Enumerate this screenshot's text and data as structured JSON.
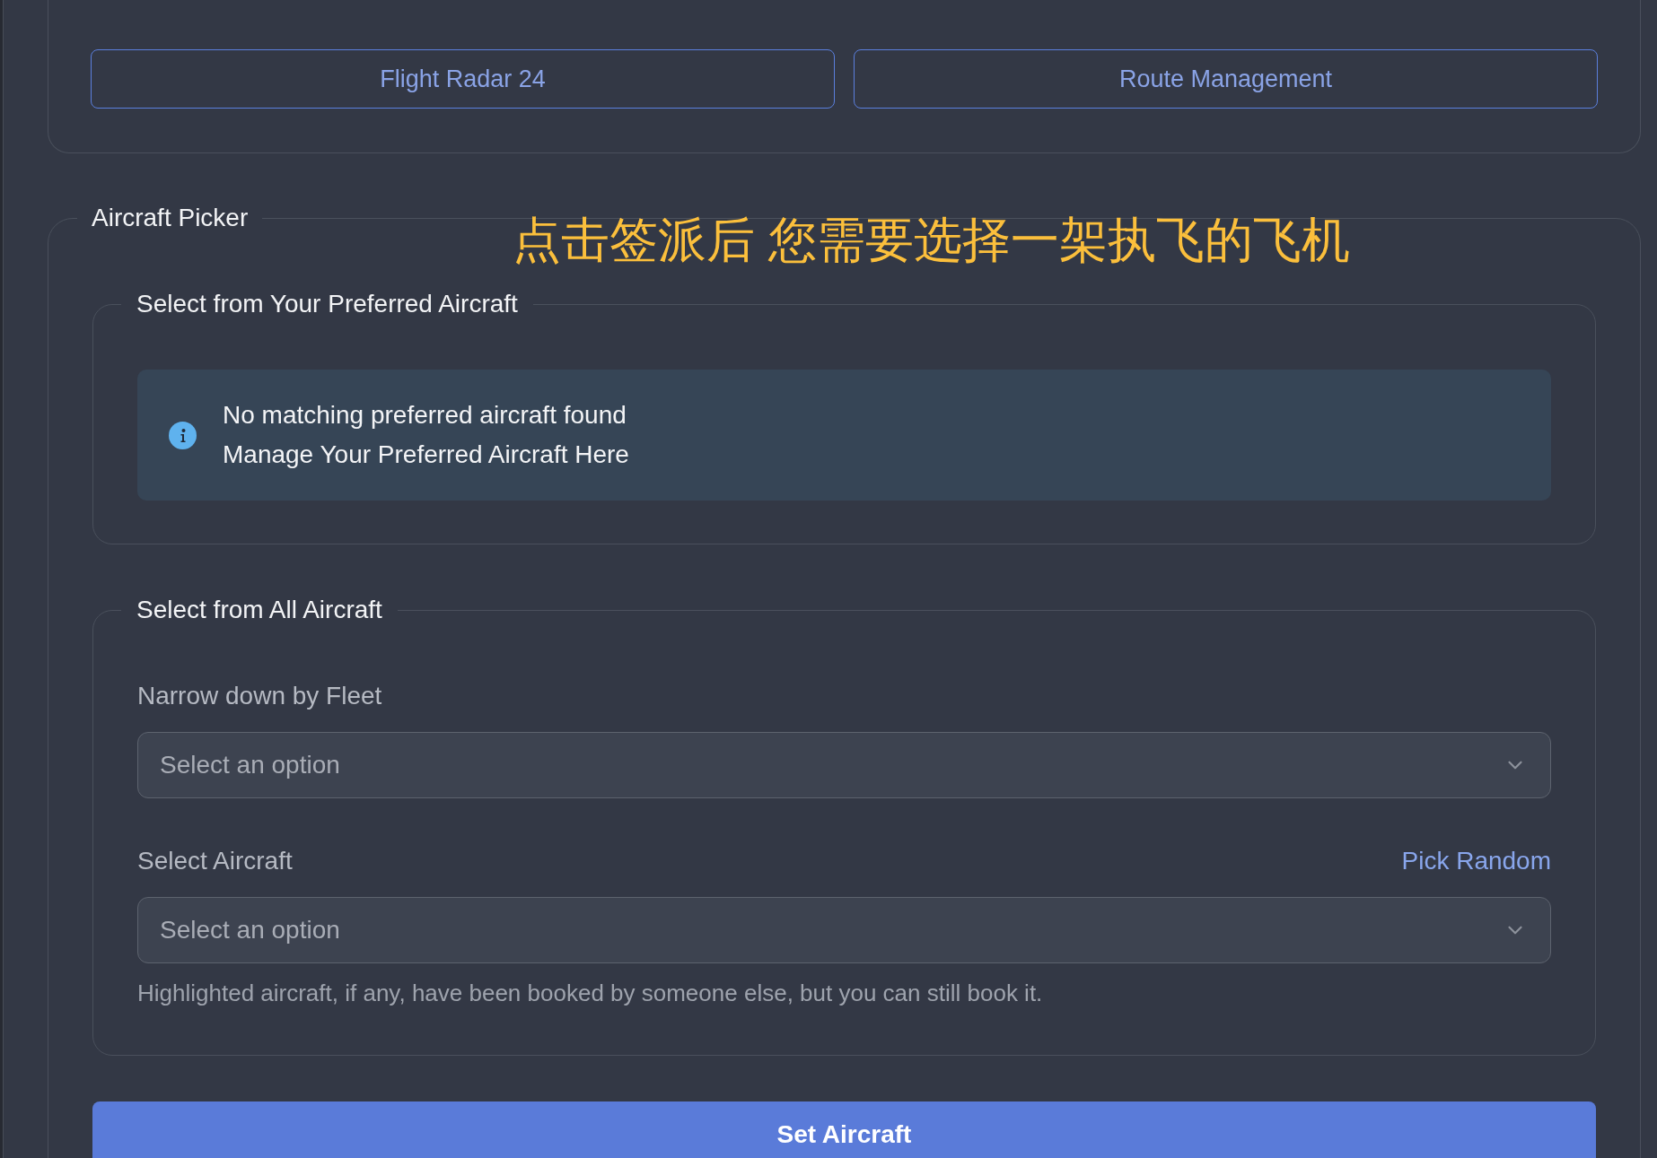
{
  "top_buttons": [
    {
      "label": "Flight Radar 24"
    },
    {
      "label": "Route Management"
    }
  ],
  "annotation": {
    "text": "点击签派后 您需要选择一架执飞的飞机"
  },
  "aircraft_picker": {
    "title": "Aircraft Picker",
    "preferred": {
      "title": "Select from Your Preferred Aircraft",
      "notice": {
        "message": "No matching preferred aircraft found",
        "link": "Manage Your Preferred Aircraft Here"
      }
    },
    "all": {
      "title": "Select from All Aircraft",
      "fields": [
        {
          "label": "Narrow down by Fleet",
          "placeholder": "Select an option"
        },
        {
          "label": "Select Aircraft",
          "action": "Pick Random",
          "placeholder": "Select an option",
          "hint": "Highlighted aircraft, if any, have been booked by someone else, but you can still book it."
        }
      ]
    },
    "submit": "Set Aircraft"
  }
}
